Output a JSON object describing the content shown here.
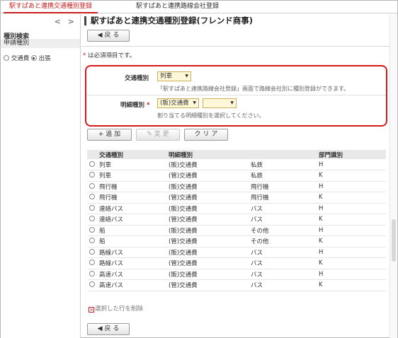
{
  "tabs": [
    {
      "label": "駅すぱあと連携交通種別登録",
      "active": true
    },
    {
      "label": "駅すぱあと連携路線会社登録",
      "active": false
    }
  ],
  "left": {
    "nav_prev": "<",
    "nav_next": ">",
    "section_title": "種別検索",
    "sub_title": "申請種別",
    "radio_options": [
      {
        "label": "交通費",
        "selected": false
      },
      {
        "label": "出張",
        "selected": true
      }
    ]
  },
  "main": {
    "title": "駅すぱあと連携交通種別登録(フレンド商事)",
    "back_label": "◀ 戻 る",
    "required_note": "は必須項目です。",
    "required_mark": "*",
    "form": {
      "transport_label": "交通種別",
      "transport_value": "列車",
      "transport_note": "「駅すぱあと連携路線会社登録」画面で路線会社別に種別登録ができます。",
      "detail_label": "明細種別",
      "detail_required": "*",
      "detail_value": "(販)交通費",
      "detail_value2": "",
      "detail_note": "割り当てる明細種別を選択してください。"
    },
    "actions": {
      "add_label": "+ 追 加",
      "change_label": "✎ 変 更",
      "clear_label": "ク リ ア"
    },
    "table": {
      "headers": [
        "交通種別",
        "明細種別",
        "",
        "部門識別"
      ],
      "rows": [
        [
          "列車",
          "(販)交通費",
          "私鉄",
          "H"
        ],
        [
          "列車",
          "(管)交通費",
          "私鉄",
          "K"
        ],
        [
          "飛行機",
          "(販)交通費",
          "飛行機",
          "H"
        ],
        [
          "飛行機",
          "(管)交通費",
          "飛行機",
          "K"
        ],
        [
          "連絡バス",
          "(販)交通費",
          "バス",
          "H"
        ],
        [
          "連絡バス",
          "(管)交通費",
          "バス",
          "K"
        ],
        [
          "船",
          "(販)交通費",
          "その他",
          "H"
        ],
        [
          "船",
          "(管)交通費",
          "その他",
          "K"
        ],
        [
          "路線バス",
          "(販)交通費",
          "バス",
          "H"
        ],
        [
          "路線バス",
          "(管)交通費",
          "バス",
          "K"
        ],
        [
          "高速バス",
          "(販)交通費",
          "バス",
          "H"
        ],
        [
          "高速バス",
          "(管)交通費",
          "バス",
          "K"
        ]
      ]
    },
    "delete_label": "選択した行を削除",
    "delete_icon": "x-box-icon"
  },
  "colors": {
    "accent": "#c81e1e",
    "select_bg": "#fff8d8"
  }
}
